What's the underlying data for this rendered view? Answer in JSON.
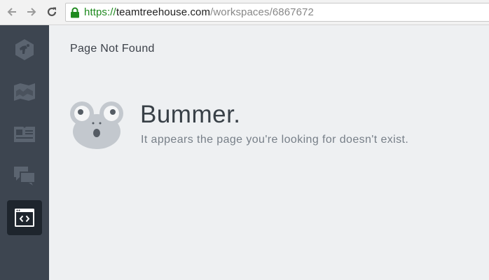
{
  "browser": {
    "url_scheme": "https://",
    "url_host": "teamtreehouse.com",
    "url_path": "/workspaces/6867672"
  },
  "sidebar": {
    "items": [
      {
        "icon": "treehouse-logo-icon",
        "active": false
      },
      {
        "icon": "library-map-icon",
        "active": false
      },
      {
        "icon": "profile-card-icon",
        "active": false
      },
      {
        "icon": "community-chat-icon",
        "active": false
      },
      {
        "icon": "workspace-code-icon",
        "active": true
      }
    ]
  },
  "main": {
    "page_title": "Page Not Found",
    "error_heading": "Bummer.",
    "error_message": "It appears the page you're looking for doesn't exist.",
    "mascot_icon": "frog-mascot-icon"
  },
  "colors": {
    "sidebar_bg": "#3d4550",
    "sidebar_active_bg": "#1e252d",
    "sidebar_icon": "#5b6470",
    "content_bg": "#eef0f2",
    "heading": "#384047",
    "subtext": "#777f88",
    "secure_green": "#1f8a1f"
  }
}
